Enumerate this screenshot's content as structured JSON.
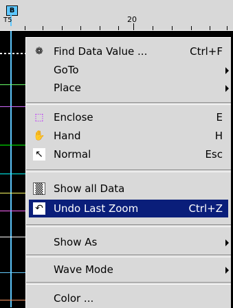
{
  "ruler": {
    "marker_label": "B",
    "marker_sub": "T5",
    "tick_label": "20"
  },
  "menu": {
    "items": [
      {
        "label": "Find Data Value ...",
        "shortcut": "Ctrl+F",
        "icon": "binoculars-icon",
        "glyph": "❁"
      },
      {
        "label": "GoTo",
        "shortcut": "",
        "submenu": true
      },
      {
        "label": "Place",
        "shortcut": "",
        "submenu": true
      },
      {
        "label": "Enclose",
        "shortcut": "E",
        "icon": "enclose-icon",
        "glyph": "⬚"
      },
      {
        "label": "Hand",
        "shortcut": "H",
        "icon": "hand-icon",
        "glyph": "✋"
      },
      {
        "label": "Normal",
        "shortcut": "Esc",
        "icon": "pointer-icon",
        "glyph": "↖"
      },
      {
        "label": "Show all Data",
        "shortcut": "",
        "icon": "show-all-data-icon",
        "glyph": "▒"
      },
      {
        "label": "Undo Last Zoom",
        "shortcut": "Ctrl+Z",
        "icon": "undo-icon",
        "glyph": "↶",
        "highlighted": true
      },
      {
        "label": "Show As",
        "shortcut": "",
        "submenu": true
      },
      {
        "label": "Wave Mode",
        "shortcut": "",
        "submenu": true
      },
      {
        "label": "Color ...",
        "shortcut": ""
      }
    ]
  },
  "colors": {
    "menu_bg": "#d9d9d9",
    "highlight": "#0a1e7a",
    "marker": "#5ec8ff"
  }
}
